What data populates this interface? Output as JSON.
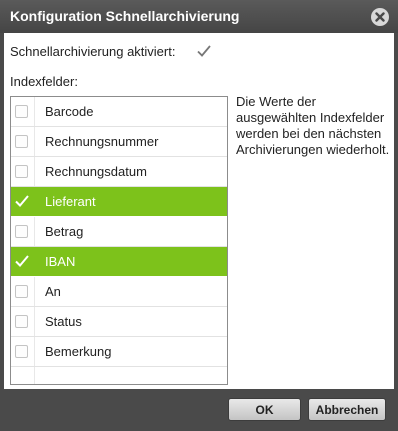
{
  "dialog": {
    "title": "Konfiguration Schnellarchivierung",
    "close_icon": "close-icon"
  },
  "settings": {
    "enable_label": "Schnellarchivierung aktiviert:",
    "enabled": true,
    "index_label": "Indexfelder:"
  },
  "index_fields": [
    {
      "label": "Barcode",
      "checked": false
    },
    {
      "label": "Rechnungsnummer",
      "checked": false
    },
    {
      "label": "Rechnungsdatum",
      "checked": false
    },
    {
      "label": "Lieferant",
      "checked": true
    },
    {
      "label": "Betrag",
      "checked": false
    },
    {
      "label": "IBAN",
      "checked": true
    },
    {
      "label": "An",
      "checked": false
    },
    {
      "label": "Status",
      "checked": false
    },
    {
      "label": "Bemerkung",
      "checked": false
    }
  ],
  "info_text": "Die Werte der ausgewählten Indexfelder werden bei den nächsten Archivierungen wiederholt.",
  "buttons": {
    "ok": "OK",
    "cancel": "Abbrechen"
  },
  "colors": {
    "selected_row": "#7dc21b",
    "titlebar": "#4a4a4a"
  }
}
